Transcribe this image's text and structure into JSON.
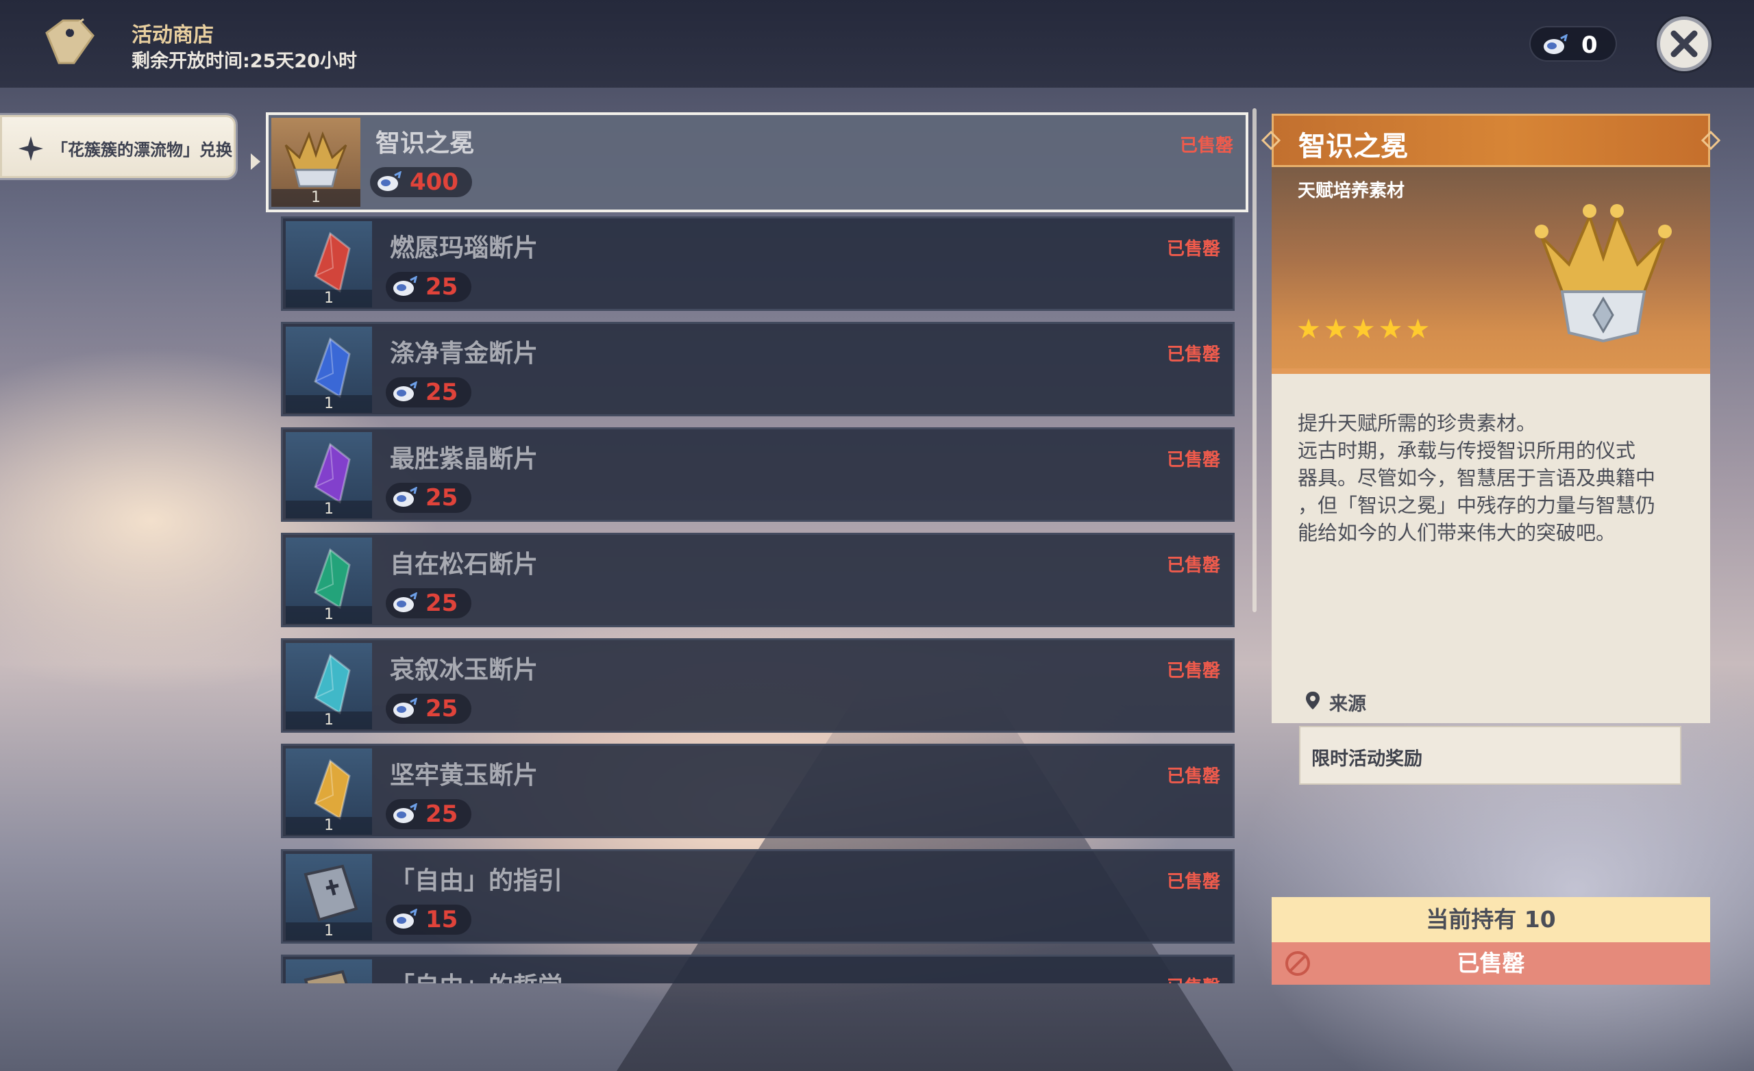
{
  "header": {
    "title": "活动商店",
    "time_remaining": "剩余开放时间:25天20小时",
    "currency_count": "0"
  },
  "tab": {
    "label": "「花簇簇的漂流物」兑换"
  },
  "items": [
    {
      "name": "智识之冕",
      "price": "400",
      "count": "1",
      "status": "已售罄",
      "icon": "crown-icon",
      "color": "#d4a64a"
    },
    {
      "name": "燃愿玛瑙断片",
      "price": "25",
      "count": "1",
      "status": "已售罄",
      "icon": "gem-fragment-icon",
      "color": "#d2453b"
    },
    {
      "name": "涤净青金断片",
      "price": "25",
      "count": "1",
      "status": "已售罄",
      "icon": "gem-fragment-icon",
      "color": "#3a68d6"
    },
    {
      "name": "最胜紫晶断片",
      "price": "25",
      "count": "1",
      "status": "已售罄",
      "icon": "gem-fragment-icon",
      "color": "#8240cc"
    },
    {
      "name": "自在松石断片",
      "price": "25",
      "count": "1",
      "status": "已售罄",
      "icon": "gem-fragment-icon",
      "color": "#23a37a"
    },
    {
      "name": "哀叙冰玉断片",
      "price": "25",
      "count": "1",
      "status": "已售罄",
      "icon": "gem-fragment-icon",
      "color": "#40b8c8"
    },
    {
      "name": "坚牢黄玉断片",
      "price": "25",
      "count": "1",
      "status": "已售罄",
      "icon": "gem-fragment-icon",
      "color": "#e0a83a"
    },
    {
      "name": "「自由」的指引",
      "price": "15",
      "count": "1",
      "status": "已售罄",
      "icon": "book-icon",
      "color": "#9aa2b0"
    },
    {
      "name": "「自由」的哲学",
      "price": "",
      "count": "",
      "status": "已售罄",
      "icon": "book-icon",
      "color": "#b09a7a"
    }
  ],
  "detail": {
    "title": "智识之冕",
    "type": "天赋培养素材",
    "stars": "★★★★★",
    "rarity": 5,
    "description_lines": [
      "提升天赋所需的珍贵素材。",
      "远古时期，承载与传授智识所用的仪式",
      "器具。尽管如今，智慧居于言语及典籍中",
      "，但「智识之冕」中残存的力量与智慧仍",
      "能给如今的人们带来伟大的突破吧。"
    ],
    "source_label": "来源",
    "source_value": "限时活动奖励",
    "holding": "当前持有 10",
    "status": "已售罄"
  }
}
